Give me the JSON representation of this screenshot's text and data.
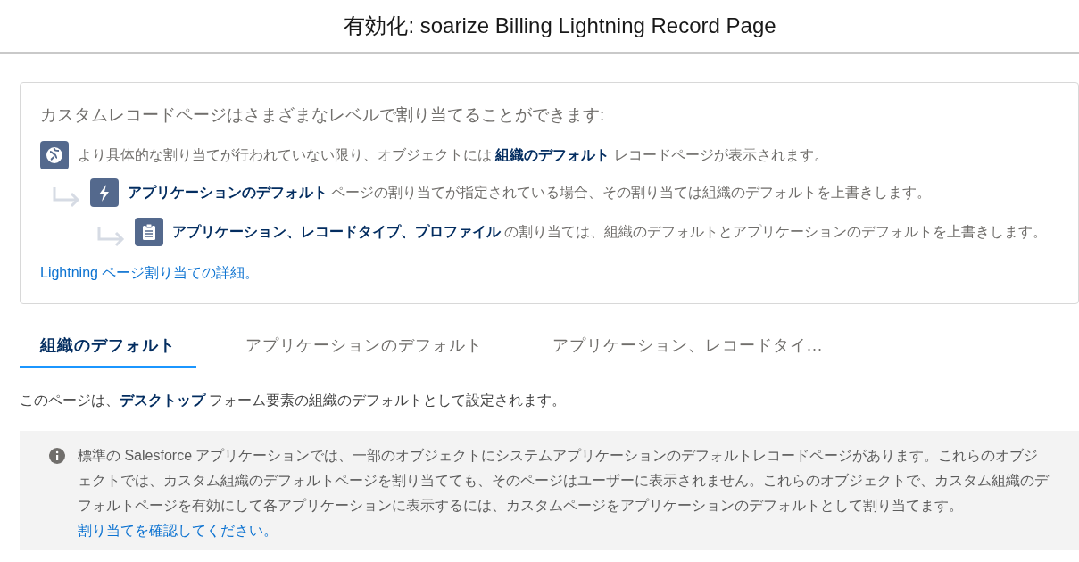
{
  "header": {
    "title": "有効化: soarize Billing Lightning Record Page"
  },
  "assignment_card": {
    "heading": "カスタムレコードページはさまざまなレベルで割り当てることができます:",
    "levels": [
      {
        "kind": "org",
        "text": "より具体的な割り当てが行われていない限り、オブジェクトには **組織のデフォルト** レコードページが表示されます。",
        "children": [
          {
            "kind": "app",
            "text": "**アプリケーションのデフォルト** ページの割り当てが指定されている場合、その割り当ては組織のデフォルトを上書きします。",
            "children": [
              {
                "kind": "profile",
                "text": "**アプリケーション、レコードタイプ、プロファイル** の割り当ては、組織のデフォルトとアプリケーションのデフォルトを上書きします。"
              }
            ]
          }
        ]
      }
    ],
    "link": "Lightning ページ割り当ての詳細。"
  },
  "tabs": [
    {
      "label": "組織のデフォルト",
      "selected": true
    },
    {
      "label": "アプリケーションのデフォルト",
      "selected": false
    },
    {
      "label": "アプリケーション、レコードタイ...",
      "selected": false
    }
  ],
  "description": "このページは、**デスクトップ** フォーム要素の組織のデフォルトとして設定されます。",
  "info_box": {
    "text": "標準の Salesforce アプリケーションでは、一部のオブジェクトにシステムアプリケーションのデフォルトレコードページがあります。これらのオブジェクトでは、カスタム組織のデフォルトページを割り当てても、そのページはユーザーに表示されません。これらのオブジェクトで、カスタム組織のデフォルトページを有効にして各アプリケーションに表示するには、カスタムページをアプリケーションのデフォルトとして割り当てます。",
    "link": "割り当てを確認してください。"
  }
}
